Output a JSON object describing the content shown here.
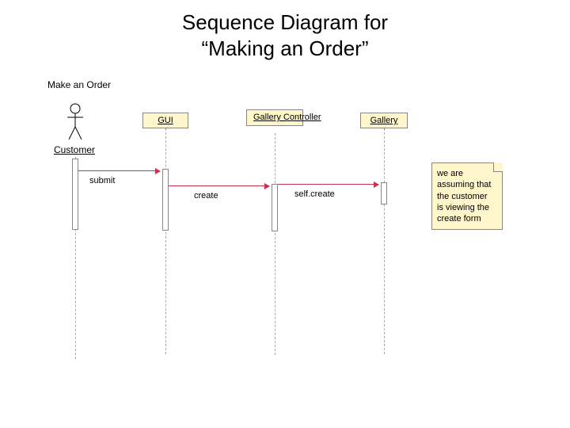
{
  "title": {
    "line1": "Sequence Diagram for",
    "line2": "“Making an Order”"
  },
  "diagram_name": "Make an Order",
  "participants": {
    "customer": "Customer",
    "gui": "GUI",
    "gallery_controller": "Gallery Controller",
    "gallery": "Gallery"
  },
  "messages": {
    "submit": "submit",
    "create": "create",
    "self_create": "self.create"
  },
  "note": "we are assuming that the customer is viewing the create form"
}
